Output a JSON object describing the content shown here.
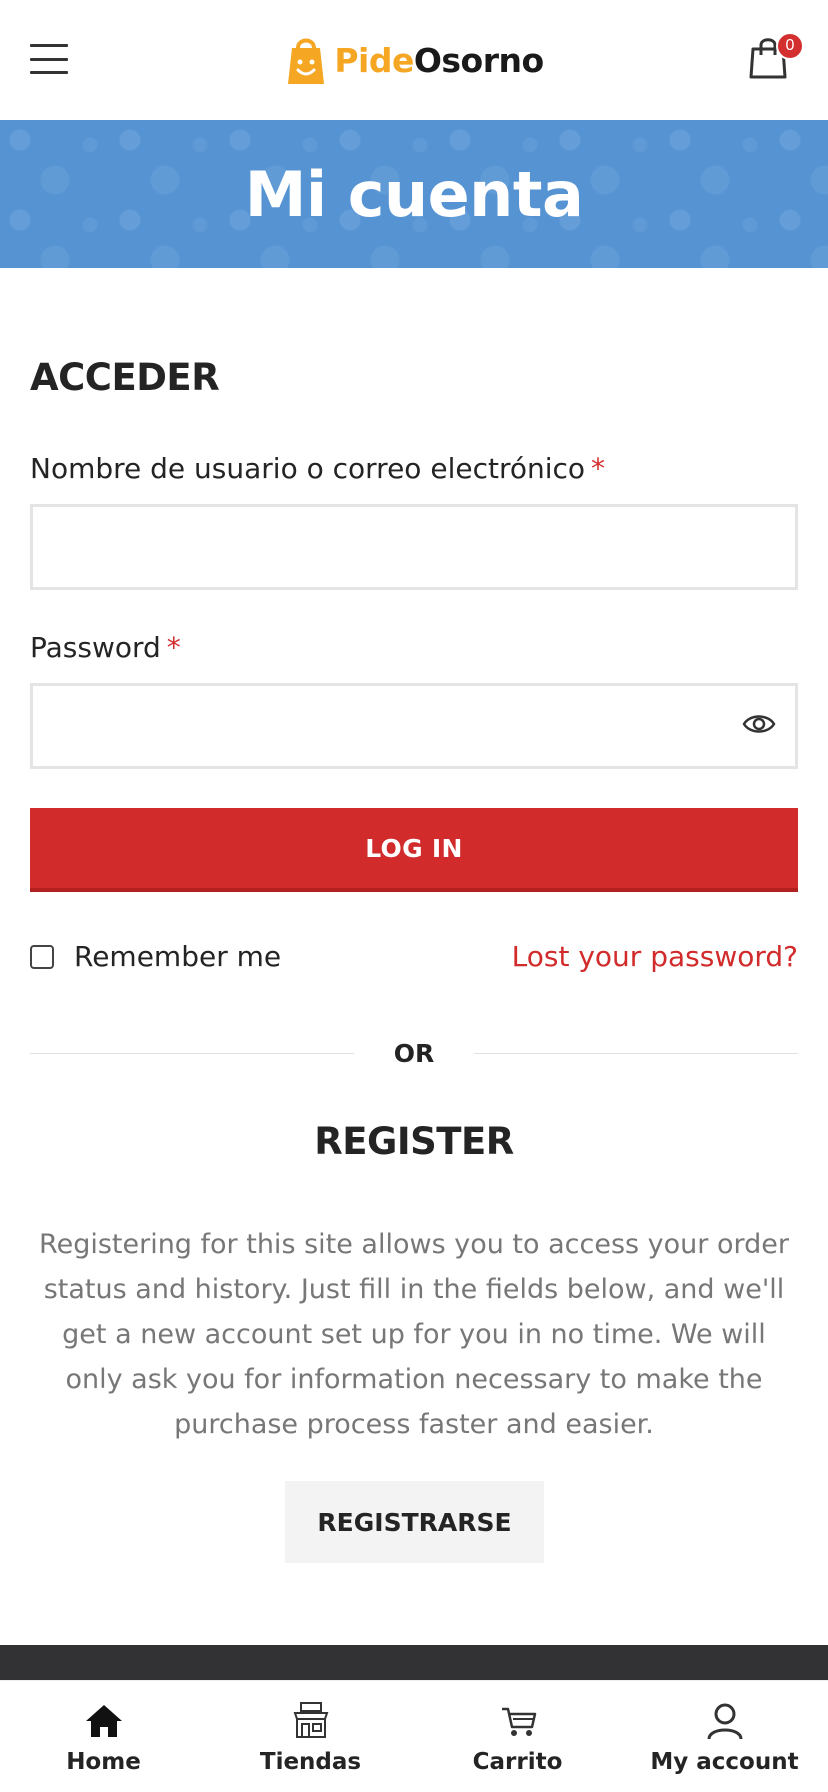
{
  "header": {
    "logo_part1": "Pide",
    "logo_part2": "Osorno",
    "cart_count": "0",
    "menu_icon": "hamburger-icon",
    "cart_icon": "shopping-bag-icon"
  },
  "banner": {
    "title": "Mi cuenta",
    "color": "#5593d3"
  },
  "login": {
    "heading": "ACCEDER",
    "username_label": "Nombre de usuario o correo electrónico",
    "username_value": "",
    "password_label": "Password",
    "password_value": "",
    "required_mark": "*",
    "button_label": "LOG IN",
    "remember_label": "Remember me",
    "remember_checked": false,
    "lost_password": "Lost your password?",
    "button_color": "#d12b2b"
  },
  "divider": {
    "text": "OR"
  },
  "register": {
    "heading": "REGISTER",
    "description": "Registering for this site allows you to access your order status and history. Just fill in the fields below, and we'll get a new account set up for you in no time. We will only ask you for information necessary to make the purchase process faster and easier.",
    "button_label": "REGISTRARSE"
  },
  "bottom_nav": {
    "items": [
      {
        "label": "Home",
        "icon": "home-icon"
      },
      {
        "label": "Tiendas",
        "icon": "store-icon"
      },
      {
        "label": "Carrito",
        "icon": "cart-icon"
      },
      {
        "label": "My account",
        "icon": "user-icon"
      }
    ]
  }
}
